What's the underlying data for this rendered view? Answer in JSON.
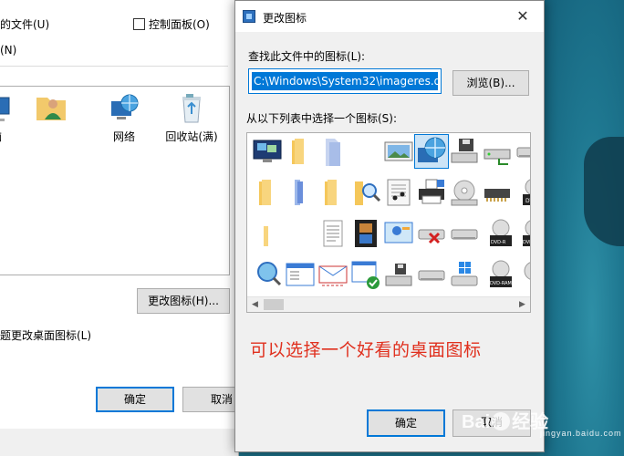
{
  "background_dialog": {
    "checkbox_files_label": "的文件(U)",
    "checkbox_control_panel_label": "控制面板(O)",
    "option_n_label": "(N)",
    "desktop_icons": [
      {
        "label": "脑",
        "icon": "computer-icon"
      },
      {
        "label": "",
        "icon": "user-folder-icon"
      },
      {
        "label": "网络",
        "icon": "network-icon"
      },
      {
        "label": "回收站(满)",
        "icon": "recycle-bin-icon"
      }
    ],
    "change_icon_button": "更改图标(H)...",
    "theme_change_label": "题更改桌面图标(L)",
    "ok_button": "确定",
    "cancel_button": "取消"
  },
  "change_icon_dialog": {
    "title": "更改图标",
    "file_label": "查找此文件中的图标(L):",
    "file_path": "C:\\Windows\\System32\\imageres.dll",
    "browse_button": "浏览(B)...",
    "list_label": "从以下列表中选择一个图标(S):",
    "grid_icons": [
      "monitor-windows-icon",
      "folder-icon",
      "blank-pages-icon",
      "empty-icon",
      "picture-icon",
      "globe-monitor-icon",
      "drive-with-floppy-icon",
      "network-drive-icon",
      "drive-icon",
      "shield-icon",
      "folder-icon",
      "folder-blue-icon",
      "folder-icon",
      "folder-search-icon",
      "music-sheet-icon",
      "printer-icon",
      "cd-drive-icon",
      "memory-card-icon",
      "dvd-drive-icon",
      "document-icon",
      "folder-half-icon",
      "empty-icon",
      "text-document-icon",
      "film-icon",
      "slideshow-icon",
      "drive-error-icon",
      "drive-icon",
      "dvd-r-icon",
      "dvd-rw-icon",
      "folder-icon",
      "search-computer-icon",
      "window-list-icon",
      "letter-icon",
      "check-window-icon",
      "floppy-drive-icon",
      "drive-icon",
      "windows-drive-icon",
      "dvd-ram-icon",
      "disc-icon"
    ],
    "ok_button": "确定",
    "cancel_button": "取消"
  },
  "annotation": "可以选择一个好看的桌面图标",
  "watermark": {
    "brand": "Bai",
    "brand2": "经验",
    "url": "jingyan.baidu.com"
  },
  "colors": {
    "accent": "#0078d7",
    "annotation": "#e0301e"
  }
}
